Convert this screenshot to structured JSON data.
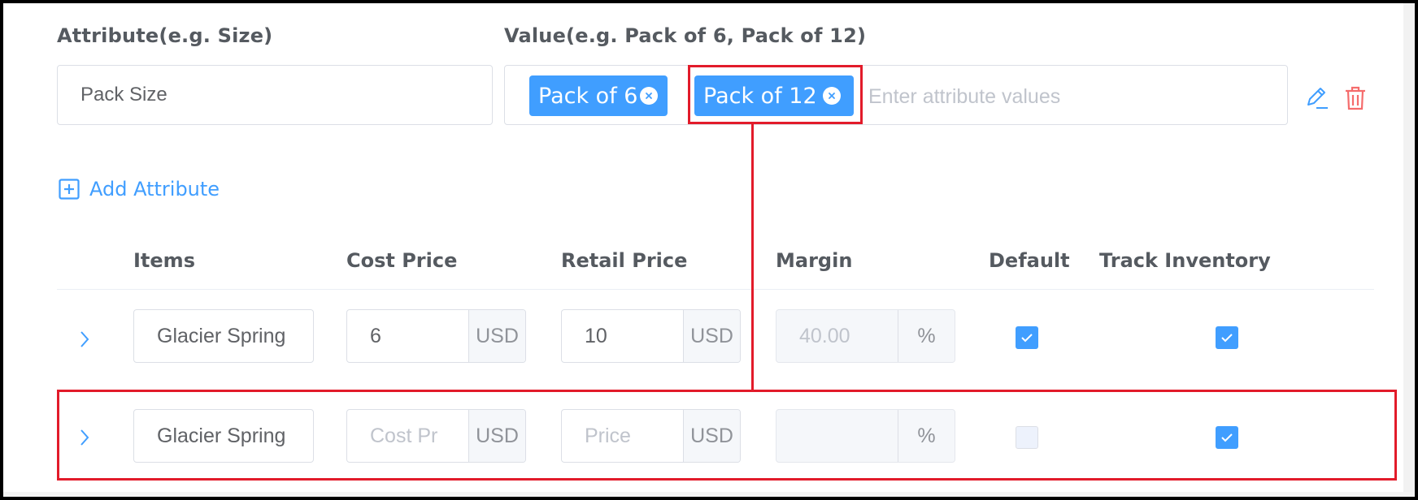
{
  "attribute": {
    "name_label": "Attribute(e.g. Size)",
    "value_label": "Value(e.g. Pack of 6, Pack of 12)",
    "name_value": "Pack Size",
    "tags": [
      "Pack of 6",
      "Pack of 12"
    ],
    "values_placeholder": "Enter attribute values"
  },
  "add_attribute_label": "Add Attribute",
  "table": {
    "columns": [
      "Items",
      "Cost Price",
      "Retail Price",
      "Margin",
      "Default",
      "Track Inventory"
    ],
    "rows": [
      {
        "item": "Glacier Spring",
        "cost": "6",
        "cost_placeholder": "",
        "cost_currency": "USD",
        "retail": "10",
        "retail_placeholder": "",
        "retail_currency": "USD",
        "margin": "40.00",
        "margin_unit": "%",
        "default_checked": true,
        "track_checked": true
      },
      {
        "item": "Glacier Spring",
        "cost": "",
        "cost_placeholder": "Cost Pr",
        "cost_currency": "USD",
        "retail": "",
        "retail_placeholder": "Price",
        "retail_currency": "USD",
        "margin": "",
        "margin_unit": "%",
        "default_checked": false,
        "track_checked": true
      }
    ]
  },
  "colors": {
    "accent": "#409eff",
    "delete": "#f56c6c",
    "highlight": "#e21b2a"
  }
}
